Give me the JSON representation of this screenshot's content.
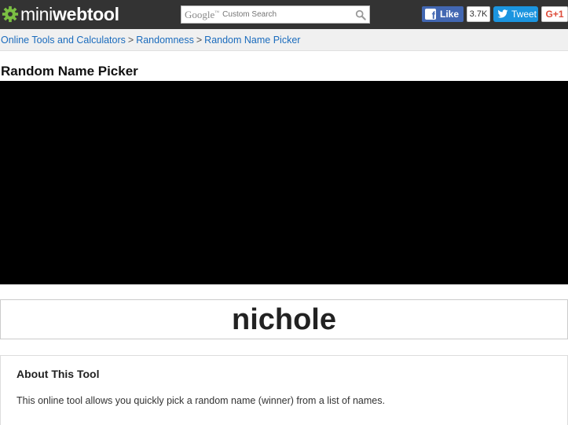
{
  "header": {
    "logo_part1": "mini",
    "logo_part2": "webtool",
    "search": {
      "brand": "Google",
      "placeholder": "Custom Search"
    },
    "social": {
      "like_label": "Like",
      "like_count": "3.7K",
      "tweet_label": "Tweet",
      "gplus_label": "G+1"
    }
  },
  "breadcrumb": {
    "items": [
      "Online Tools and Calculators",
      "Randomness",
      "Random Name Picker"
    ],
    "separator": ">"
  },
  "main": {
    "title": "Random Name Picker",
    "result_name": "nichole"
  },
  "about": {
    "title": "About This Tool",
    "text": "This online tool allows you quickly pick a random name (winner) from a list of names."
  },
  "colors": {
    "header_bg": "#333333",
    "link": "#1a6bbd",
    "facebook": "#4267b2",
    "twitter": "#1b95e0",
    "gplus": "#dd4b39",
    "logo_gear": "#7bc043"
  }
}
